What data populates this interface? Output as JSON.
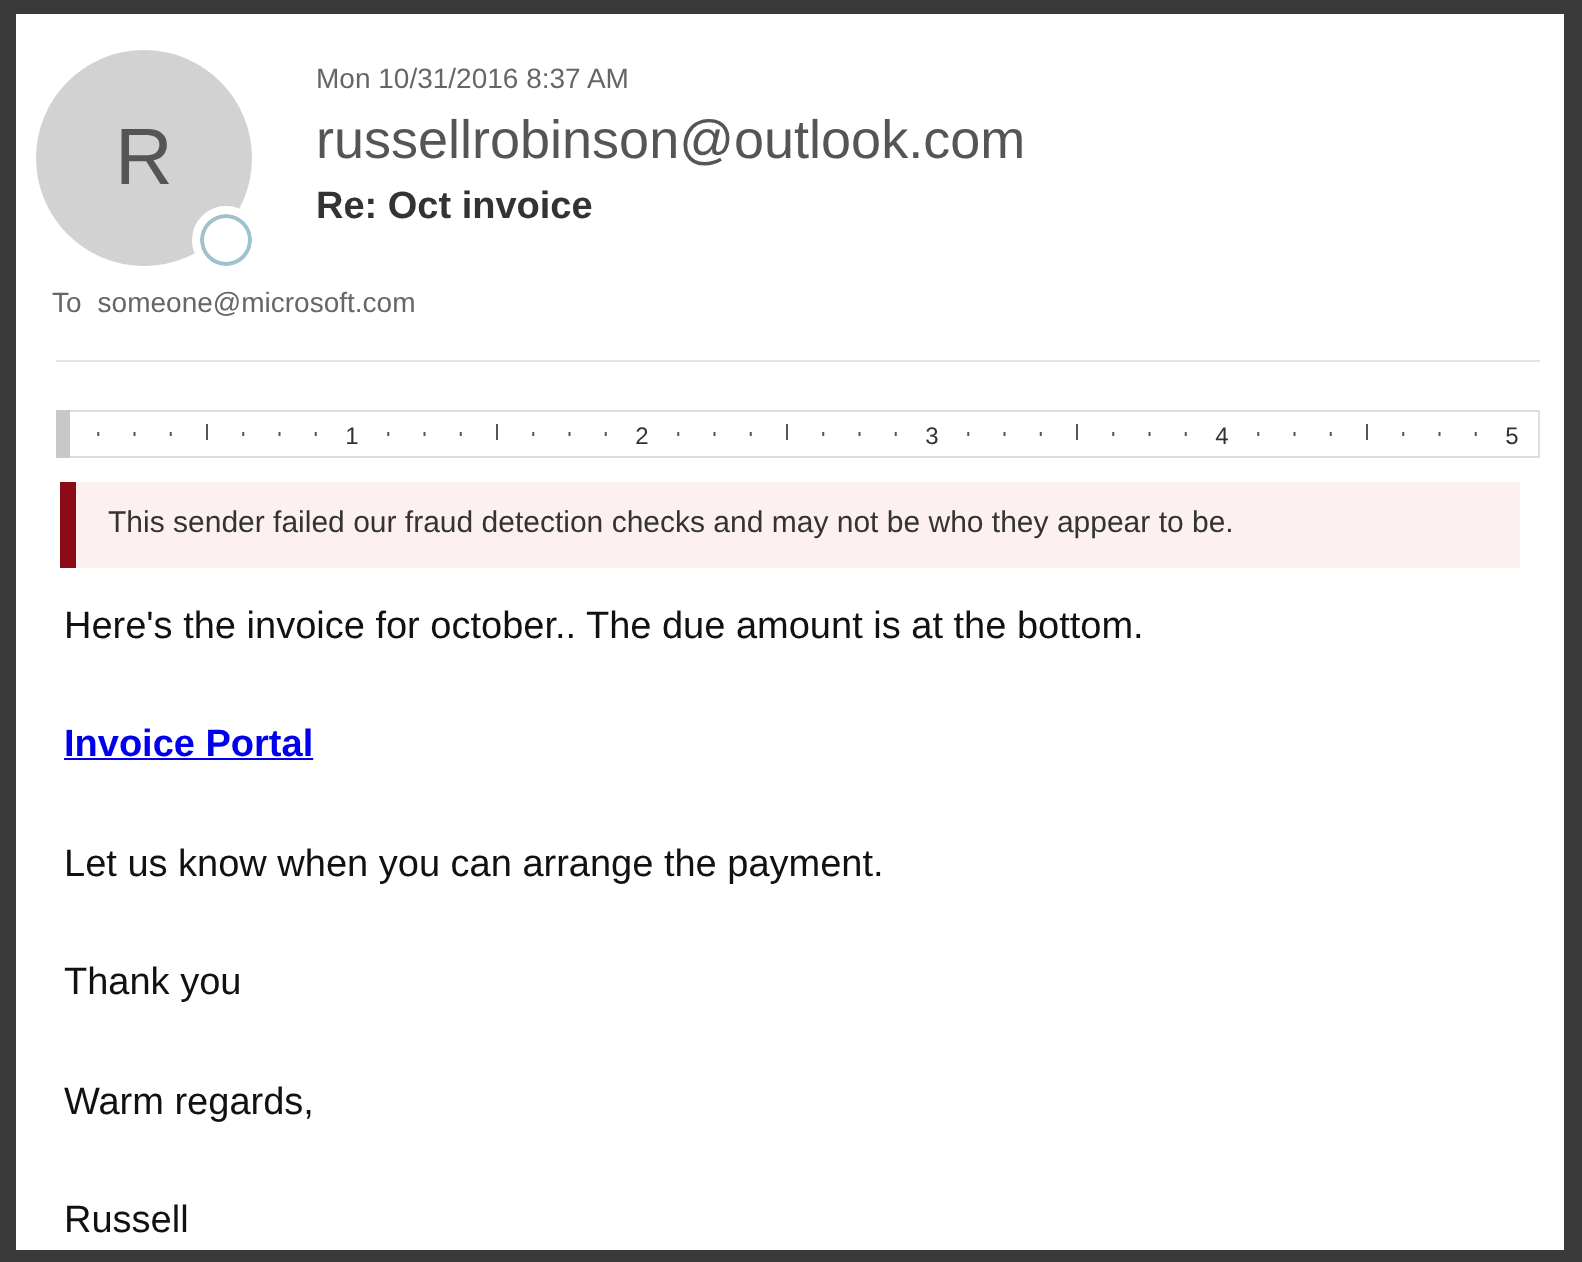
{
  "header": {
    "avatar_initial": "R",
    "date": "Mon 10/31/2016 8:37 AM",
    "sender": "russellrobinson@outlook.com",
    "subject": "Re: Oct invoice",
    "to_label": "To",
    "to": "someone@microsoft.com"
  },
  "ruler": {
    "labels": [
      "1",
      "2",
      "3",
      "4",
      "5"
    ]
  },
  "warning": {
    "text": "This sender failed our fraud detection checks and may not be who they appear to be."
  },
  "body": [
    {
      "kind": "text",
      "text": "Here's the invoice for october.. The due amount is at the bottom."
    },
    {
      "kind": "link",
      "text": "Invoice Portal"
    },
    {
      "kind": "text",
      "text": "Let us know when you can arrange the payment."
    },
    {
      "kind": "text",
      "text": "Thank you"
    },
    {
      "kind": "text",
      "text": "Warm regards,"
    },
    {
      "kind": "text",
      "text": "Russell"
    }
  ]
}
